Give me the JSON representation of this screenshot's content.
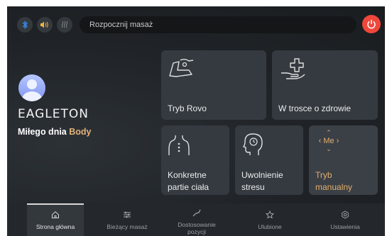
{
  "topbar": {
    "icons": [
      "bluetooth-icon",
      "volume-icon",
      "heat-icon"
    ],
    "start_label": "Rozpocznij masaż",
    "power_icon": "power-icon"
  },
  "profile": {
    "brand": "EAGLETON",
    "greeting_prefix": "Miłego dnia",
    "user_name": "Body"
  },
  "cards": {
    "rovo": {
      "label": "Tryb Rovo",
      "icon": "massage-chair-icon"
    },
    "health": {
      "label": "W trosce o zdrowie",
      "icon": "health-care-icon"
    },
    "body_parts": {
      "label_line1": "Konkretne",
      "label_line2": "partie ciała",
      "icon": "body-parts-icon"
    },
    "stress": {
      "label_line1": "Uwolnienie",
      "label_line2": "stresu",
      "icon": "head-relax-icon"
    },
    "manual": {
      "label_line1": "Tryb",
      "label_line2": "manualny",
      "me_text": "Me",
      "icon": "manual-control-icon"
    }
  },
  "nav": {
    "home": "Strona główna",
    "current": "Bieżący masaż",
    "adjust_line1": "Dostosowanie",
    "adjust_line2": "pozycji",
    "favorites": "Ulubione",
    "settings": "Ustawienia"
  },
  "colors": {
    "accent": "#e3b37a",
    "power": "#f0473b",
    "bluetooth": "#3b8ff5",
    "volume": "#f3b43a"
  }
}
